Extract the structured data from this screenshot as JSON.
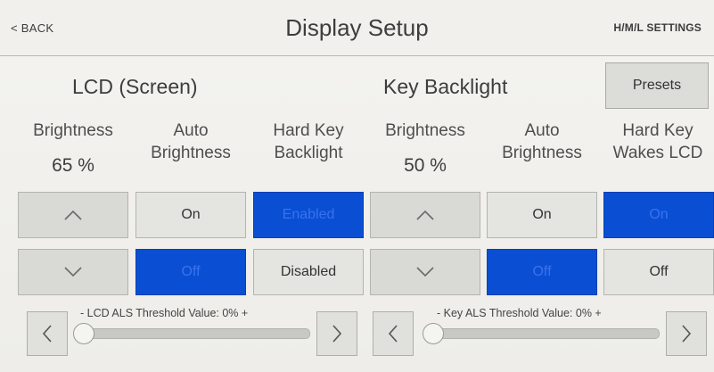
{
  "header": {
    "back_label": "< BACK",
    "title": "Display Setup",
    "hml_label": "H/M/L SETTINGS"
  },
  "lcd": {
    "section_title": "LCD (Screen)",
    "brightness_label": "Brightness",
    "brightness_value": "65 %",
    "auto_label_1": "Auto",
    "auto_label_2": "Brightness",
    "hardkey_label_1": "Hard Key",
    "hardkey_label_2": "Backlight",
    "auto_on": "On",
    "auto_off": "Off",
    "hardkey_enabled": "Enabled",
    "hardkey_disabled": "Disabled",
    "als_label": "- LCD ALS Threshold Value: 0% +",
    "als_value": 0
  },
  "key": {
    "section_title": "Key Backlight",
    "brightness_label": "Brightness",
    "brightness_value": "50 %",
    "auto_label_1": "Auto",
    "auto_label_2": "Brightness",
    "wakes_label_1": "Hard Key",
    "wakes_label_2": "Wakes LCD",
    "auto_on": "On",
    "auto_off": "Off",
    "wakes_on": "On",
    "wakes_off": "Off",
    "als_label": "- Key ALS Threshold Value: 0% +",
    "als_value": 0
  },
  "presets_label": "Presets",
  "icons": {
    "up": "chevron-up-icon",
    "down": "chevron-down-icon",
    "left": "chevron-left-icon",
    "right": "chevron-right-icon"
  },
  "colors": {
    "selected": "#0a4fd3",
    "button": "#d9d9d6",
    "background": "#f1f0ec"
  }
}
